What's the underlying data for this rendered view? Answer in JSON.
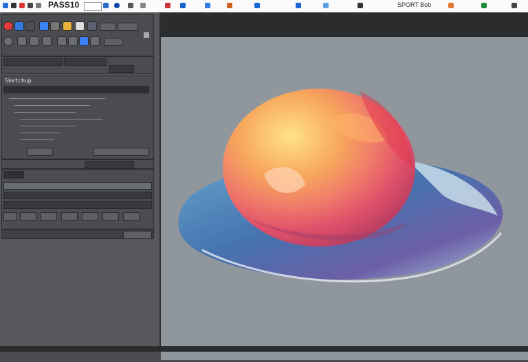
{
  "app": {
    "title": "PASS10"
  },
  "topbar": {
    "label_right": "SPORT Bob"
  },
  "left_panel": {
    "section_label": "Sketchup",
    "search_placeholder": "",
    "palette": [
      "#e23b3b",
      "#2f7be0",
      "#e0a020",
      "#49a04a",
      "#7f56d9",
      "#d9d9d9"
    ]
  },
  "canvas": {
    "subject": "watercolor-egg"
  },
  "colors": {
    "canvas_bg": "#8f979d",
    "panel_bg": "#4a4c4f",
    "top_bg": "#fbfbfb"
  }
}
